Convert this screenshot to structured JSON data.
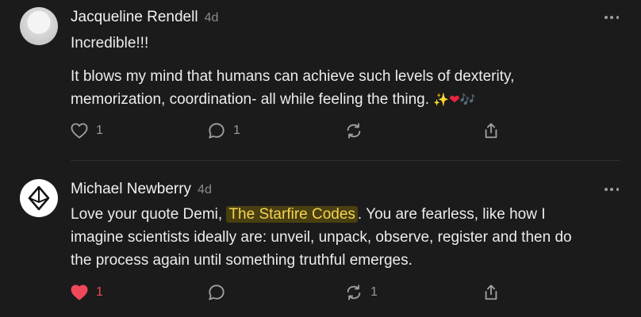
{
  "comments": [
    {
      "author": "Jacqueline Rendell",
      "time": "4d",
      "paragraphs": [
        "Incredible!!!",
        "It blows my mind that humans can achieve such levels of dexterity, memorization, coordination- all while feeling the thing."
      ],
      "emoji": [
        "✨",
        "❤",
        "🎶"
      ],
      "likes": "1",
      "replies": "1",
      "restacks": "",
      "liked": false,
      "icons": [
        "heart-icon",
        "comment-icon",
        "restack-icon",
        "share-icon",
        "more-icon"
      ]
    },
    {
      "author": "Michael Newberry",
      "time": "4d",
      "text_before": "Love your quote Demi, ",
      "mention": "The Starfire Codes",
      "text_after": ". You are fearless, like how I imagine scientists ideally are: unveil, unpack, observe, register and then do the process again until something truthful emerges.",
      "likes": "1",
      "replies": "",
      "restacks": "1",
      "liked": true,
      "icons": [
        "heart-filled-icon",
        "comment-icon",
        "restack-icon",
        "share-icon",
        "more-icon"
      ]
    }
  ],
  "colors": {
    "background": "#1b1b1b",
    "text": "#ececec",
    "muted": "#9a9a9a",
    "liked": "#f0485a",
    "mention_bg": "#4a3f10",
    "mention_text": "#f5d453"
  }
}
